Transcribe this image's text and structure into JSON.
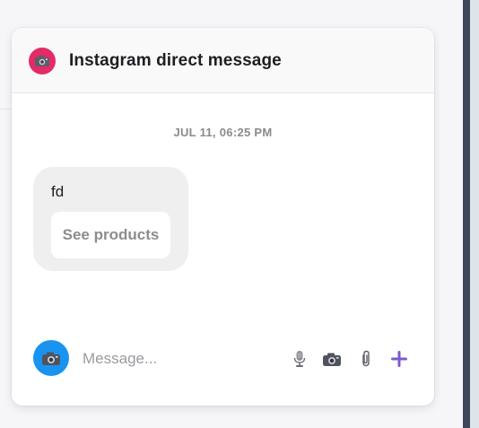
{
  "header": {
    "title": "Instagram direct message",
    "icon": "camera-icon",
    "icon_color": "#e22b67"
  },
  "conversation": {
    "timestamp": "JUL 11, 06:25 PM",
    "message": {
      "text": "fd",
      "button_label": "See products"
    }
  },
  "composer": {
    "avatar_icon": "camera-icon",
    "avatar_color": "#1894f0",
    "placeholder": "Message...",
    "tools": [
      "microphone-icon",
      "camera-icon",
      "paperclip-icon",
      "plus-icon"
    ],
    "accent_color": "#7b5bd0"
  }
}
